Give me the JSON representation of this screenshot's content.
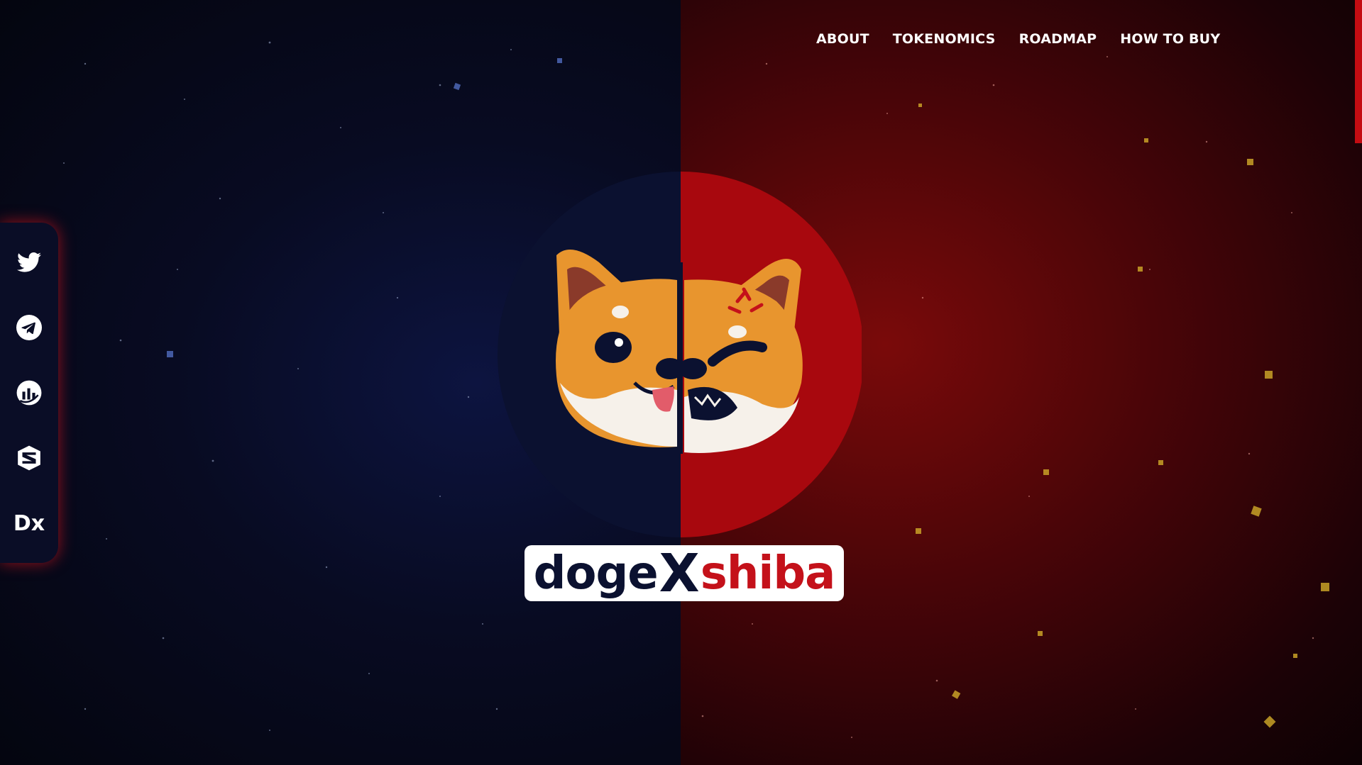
{
  "nav": {
    "items": [
      {
        "label": "ABOUT"
      },
      {
        "label": "TOKENOMICS"
      },
      {
        "label": "ROADMAP"
      },
      {
        "label": "HOW TO BUY"
      }
    ]
  },
  "social": {
    "items": [
      {
        "icon": "twitter-icon"
      },
      {
        "icon": "telegram-icon"
      },
      {
        "icon": "chart-icon"
      },
      {
        "icon": "dextools-icon"
      },
      {
        "icon": "dexscreener-icon",
        "label": "Dx"
      }
    ]
  },
  "brand": {
    "part1": "doge",
    "part2": "X",
    "part3": "shiba"
  },
  "colors": {
    "navy": "#0b1130",
    "red": "#c4111a",
    "orange": "#e8952e",
    "white": "#ffffff"
  }
}
